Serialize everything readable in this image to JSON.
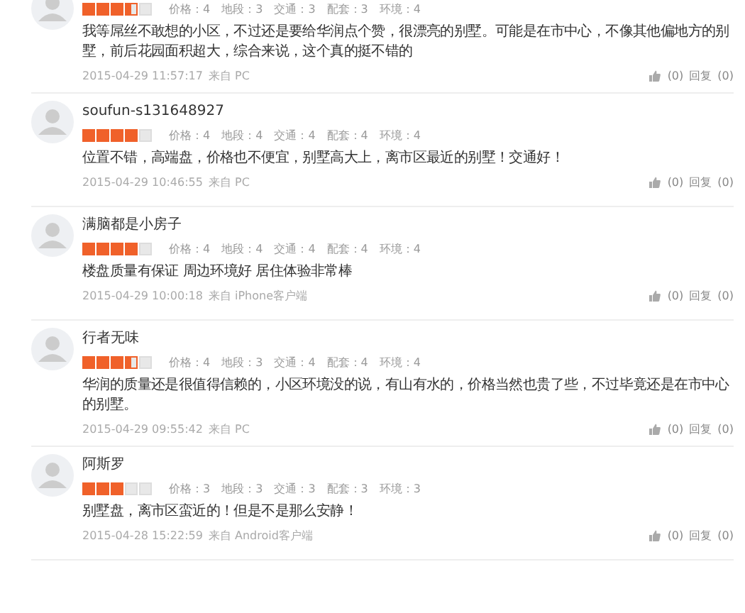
{
  "reviews": [
    {
      "stars": 3.5,
      "scores": [
        "价格：4",
        "地段：3",
        "交通：3",
        "配套：3",
        "环境：4"
      ],
      "comment": "我等屌丝不敢想的小区，不过还是要给华润点个赞，很漂亮的别墅。可能是在市中心，不像其他偏地方的别墅，前后花园面积超大，综合来说，这个真的挺不错的",
      "time": "2015-04-29 11:57:17",
      "source": "来自 PC",
      "likes": "(0)",
      "reply": "回复",
      "replies": "(0)"
    },
    {
      "user": "soufun-s131648927",
      "stars": 4,
      "scores": [
        "价格：4",
        "地段：4",
        "交通：4",
        "配套：4",
        "环境：4"
      ],
      "comment": "位置不错，高端盘，价格也不便宜，别墅高大上，离市区最近的别墅！交通好！",
      "time": "2015-04-29 10:46:55",
      "source": "来自 PC",
      "likes": "(0)",
      "reply": "回复",
      "replies": "(0)"
    },
    {
      "user": "满脑都是小房子",
      "stars": 4,
      "scores": [
        "价格：4",
        "地段：4",
        "交通：4",
        "配套：4",
        "环境：4"
      ],
      "comment": "楼盘质量有保证 周边环境好 居住体验非常棒",
      "time": "2015-04-29 10:00:18",
      "source": "来自 iPhone客户端",
      "likes": "(0)",
      "reply": "回复",
      "replies": "(0)"
    },
    {
      "user": "行者无味",
      "stars": 3.5,
      "scores": [
        "价格：4",
        "地段：3",
        "交通：4",
        "配套：4",
        "环境：4"
      ],
      "comment": "华润的质量还是很值得信赖的，小区环境没的说，有山有水的，价格当然也贵了些，不过毕竟还是在市中心的别墅。",
      "time": "2015-04-29 09:55:42",
      "source": "来自 PC",
      "likes": "(0)",
      "reply": "回复",
      "replies": "(0)"
    },
    {
      "user": "阿斯罗",
      "stars": 3,
      "scores": [
        "价格：3",
        "地段：3",
        "交通：3",
        "配套：3",
        "环境：3"
      ],
      "comment": "别墅盘，离市区蛮近的！但是不是那么安静！",
      "time": "2015-04-28 15:22:59",
      "source": "来自 Android客户端",
      "likes": "(0)",
      "reply": "回复",
      "replies": "(0)"
    }
  ]
}
